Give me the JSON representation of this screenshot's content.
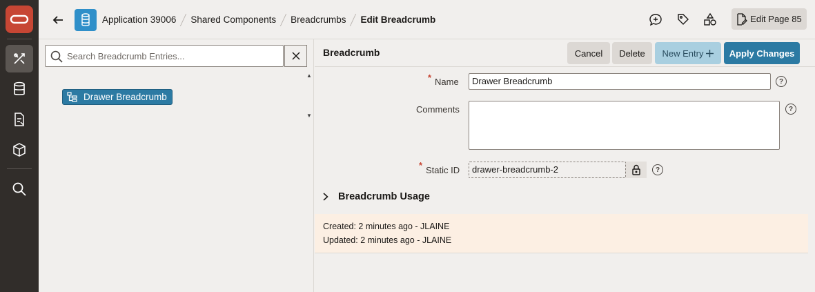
{
  "nav": {
    "logo": "oracle-logo",
    "items": [
      {
        "icon": "app-builder-icon",
        "active": true
      },
      {
        "icon": "sql-workshop-icon",
        "active": false
      },
      {
        "icon": "team-development-icon",
        "active": false
      },
      {
        "icon": "gallery-icon",
        "active": false
      },
      {
        "icon": "search-icon",
        "active": false
      }
    ]
  },
  "header": {
    "breadcrumbs": [
      "Application 39006",
      "Shared Components",
      "Breadcrumbs",
      "Edit Breadcrumb"
    ],
    "edit_page_label": "Edit Page 85"
  },
  "tree": {
    "search_placeholder": "Search Breadcrumb Entries...",
    "search_value": "",
    "node_label": "Drawer Breadcrumb"
  },
  "panel": {
    "title": "Breadcrumb",
    "cancel_label": "Cancel",
    "delete_label": "Delete",
    "new_entry_label": "New Entry",
    "apply_label": "Apply Changes"
  },
  "form": {
    "name_label": "Name",
    "name_value": "Drawer Breadcrumb",
    "comments_label": "Comments",
    "comments_value": "",
    "static_id_label": "Static ID",
    "static_id_value": "drawer-breadcrumb-2",
    "required_marker": "*",
    "help_glyph": "?"
  },
  "usage": {
    "label": "Breadcrumb Usage"
  },
  "audit": {
    "created": "Created: 2 minutes ago - JLAINE",
    "updated": "Updated: 2 minutes ago - JLAINE"
  },
  "colors": {
    "rail": "#312d2a",
    "brand_red": "#c74634",
    "primary_blue": "#2c7aa3",
    "audit_bg": "#fcefe3"
  }
}
